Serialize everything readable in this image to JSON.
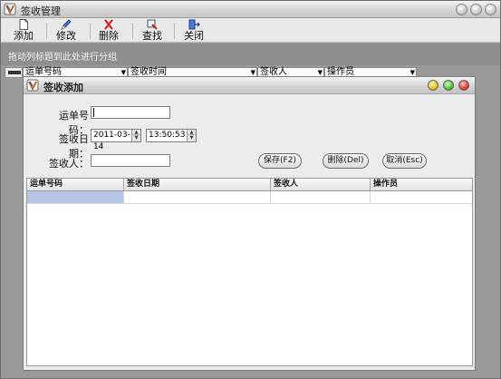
{
  "main_window": {
    "title": "签收管理",
    "toolbar": [
      {
        "label": "添加",
        "icon": "new-document-icon"
      },
      {
        "label": "修改",
        "icon": "edit-pen-icon"
      },
      {
        "label": "删除",
        "icon": "delete-x-icon"
      },
      {
        "label": "查找",
        "icon": "find-icon"
      },
      {
        "label": "关闭",
        "icon": "exit-door-icon"
      }
    ],
    "group_hint": "拖动列标题到此处进行分组",
    "columns": [
      "运单号码",
      "签收时间",
      "签收人",
      "操作员"
    ]
  },
  "dialog": {
    "title": "签收添加",
    "labels": {
      "waybill": "运单号码：",
      "sign_date": "签收日期：",
      "signer": "签收人："
    },
    "fields": {
      "waybill": "",
      "date": "2011-03-14",
      "time": "13:50:53",
      "signer": ""
    },
    "buttons": {
      "save": "保存(F2)",
      "delete": "删除(Del)",
      "cancel": "取消(Esc)"
    },
    "grid_columns": [
      "运单号码",
      "签收日期",
      "签收人",
      "操作员"
    ]
  },
  "colors": {
    "window_bg": "#9a9a9a",
    "dialog_bg": "#ececec",
    "selected_cell": "#b6c6e6"
  }
}
